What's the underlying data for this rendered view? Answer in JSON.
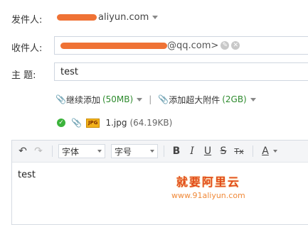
{
  "sender": {
    "label": "发件人:",
    "domain": "aliyun.com"
  },
  "recipients": {
    "label": "收件人:",
    "address_suffix": "@qq.com>"
  },
  "subject": {
    "label": "主  题:",
    "value": "test"
  },
  "attachments": {
    "add_label": "继续添加",
    "add_limit": "(50MB)",
    "separator": "|",
    "large_label": "添加超大附件",
    "large_limit": "(2GB)",
    "file_name": "1.jpg",
    "file_size": "(64.19KB)",
    "file_type": "JPG"
  },
  "toolbar": {
    "font_family": "字体",
    "font_size": "字号",
    "bold": "B",
    "italic": "I",
    "underline": "U",
    "strike": "S",
    "clear": "Tx",
    "color": "A"
  },
  "body_text": "test",
  "watermark": {
    "cn": "就要阿里云",
    "url": "www.91aliyun.com"
  }
}
